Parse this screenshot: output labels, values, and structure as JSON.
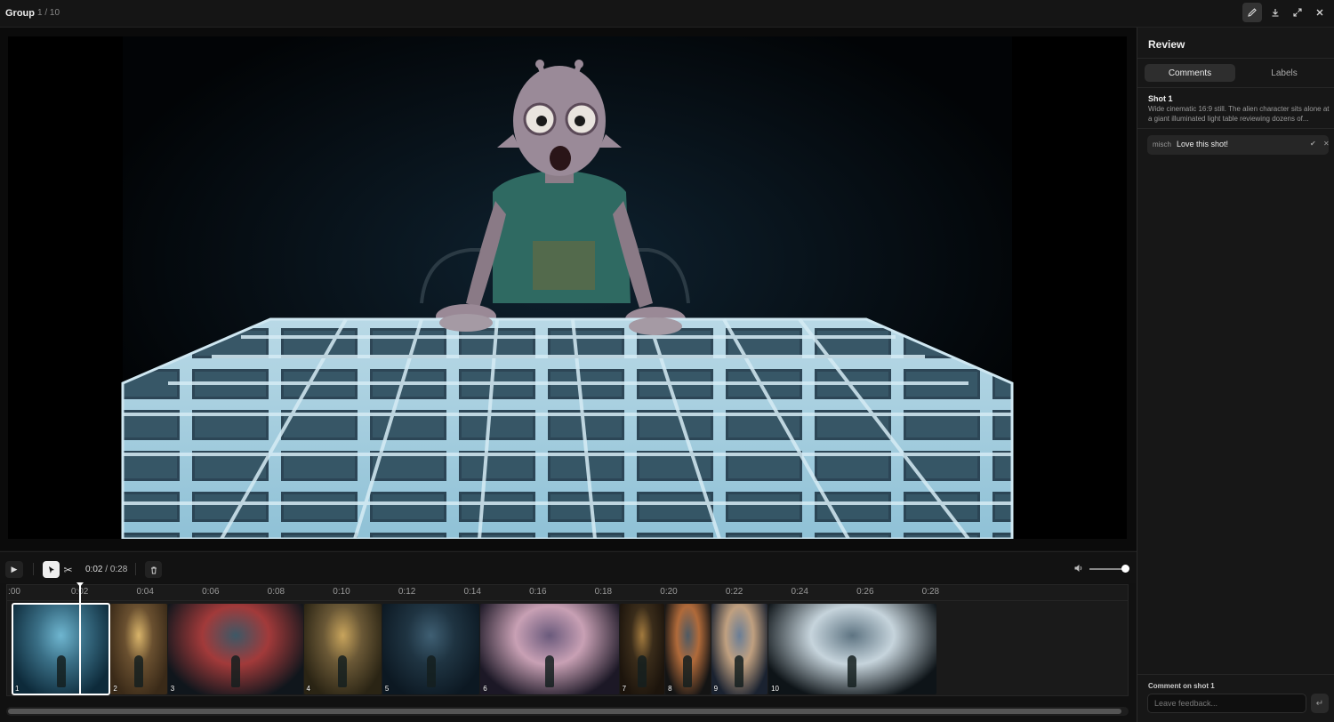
{
  "topbar": {
    "title": "Group",
    "count": "1 / 10",
    "buttons": [
      "pencil-icon",
      "download-icon",
      "expand-icon",
      "close-icon"
    ]
  },
  "controls": {
    "current_time": "0:02",
    "separator": "/",
    "total_time": "0:28",
    "volume_level": 1.0
  },
  "ruler": {
    "ticks": [
      ":00",
      "0:02",
      "0:04",
      "0:06",
      "0:08",
      "0:10",
      "0:12",
      "0:14",
      "0:16",
      "0:18",
      "0:20",
      "0:22",
      "0:24",
      "0:26",
      "0:28"
    ]
  },
  "timeline": {
    "playhead_time": "0:02",
    "clips": [
      {
        "number": "1",
        "start": 0.0,
        "end": 3.0,
        "selected": true
      },
      {
        "number": "2",
        "start": 3.0,
        "end": 4.75
      },
      {
        "number": "3",
        "start": 4.75,
        "end": 8.9
      },
      {
        "number": "4",
        "start": 8.9,
        "end": 11.3
      },
      {
        "number": "5",
        "start": 11.3,
        "end": 14.3
      },
      {
        "number": "6",
        "start": 14.3,
        "end": 18.55
      },
      {
        "number": "7",
        "start": 18.55,
        "end": 19.95
      },
      {
        "number": "8",
        "start": 19.95,
        "end": 21.35
      },
      {
        "number": "9",
        "start": 21.35,
        "end": 23.1
      },
      {
        "number": "10",
        "start": 23.1,
        "end": 28.25
      }
    ]
  },
  "panel": {
    "title": "Review",
    "tabs": [
      {
        "label": "Comments",
        "active": true
      },
      {
        "label": "Labels",
        "active": false
      }
    ],
    "shot": {
      "title": "Shot 1",
      "description": "Wide cinematic 16:9 still. The alien character sits alone at a giant illuminated light table reviewing dozens of..."
    },
    "comments": [
      {
        "user": "misch",
        "text": "Love this shot!"
      }
    ],
    "comment_label": "Comment on shot 1",
    "input_placeholder": "Leave feedback..."
  }
}
